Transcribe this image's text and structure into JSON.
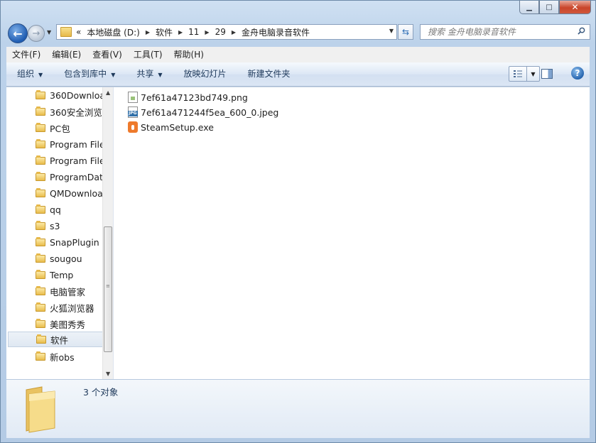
{
  "window": {
    "caption": {
      "minimize": "▁",
      "maximize": "□",
      "close": "✕"
    }
  },
  "nav": {
    "back_icon": "back-arrow-icon",
    "forward_icon": "forward-arrow-icon",
    "address": {
      "overflow": "«",
      "crumbs": [
        "本地磁盘 (D:)",
        "软件",
        "11",
        "29",
        "金舟电脑录音软件"
      ]
    },
    "search": {
      "placeholder": "搜索 金舟电脑录音软件"
    }
  },
  "menubar": {
    "items": [
      "文件(F)",
      "编辑(E)",
      "查看(V)",
      "工具(T)",
      "帮助(H)"
    ]
  },
  "cmdbar": {
    "organize": "组织",
    "include_library": "包含到库中",
    "share": "共享",
    "slideshow": "放映幻灯片",
    "new_folder": "新建文件夹"
  },
  "tree": {
    "items": [
      "360Downloa",
      "360安全浏览",
      "PC包",
      "Program File",
      "Program File",
      "ProgramData",
      "QMDownloa",
      "qq",
      "s3",
      "SnapPlugin",
      "sougou",
      "Temp",
      "电脑管家",
      "火狐浏览器",
      "美图秀秀",
      "软件",
      "新obs"
    ],
    "selected_index": 15
  },
  "files": {
    "items": [
      {
        "name": "7ef61a47123bd749.png",
        "icon": "png-file-icon"
      },
      {
        "name": "7ef61a471244f5ea_600_0.jpeg",
        "icon": "jpeg-file-icon"
      },
      {
        "name": "SteamSetup.exe",
        "icon": "exe-file-icon"
      }
    ]
  },
  "details": {
    "count": "3 个对象"
  },
  "colors": {
    "accent": "#1e395b",
    "selection": "#dfe8f2",
    "exe_icon": "#ee7a2c"
  }
}
